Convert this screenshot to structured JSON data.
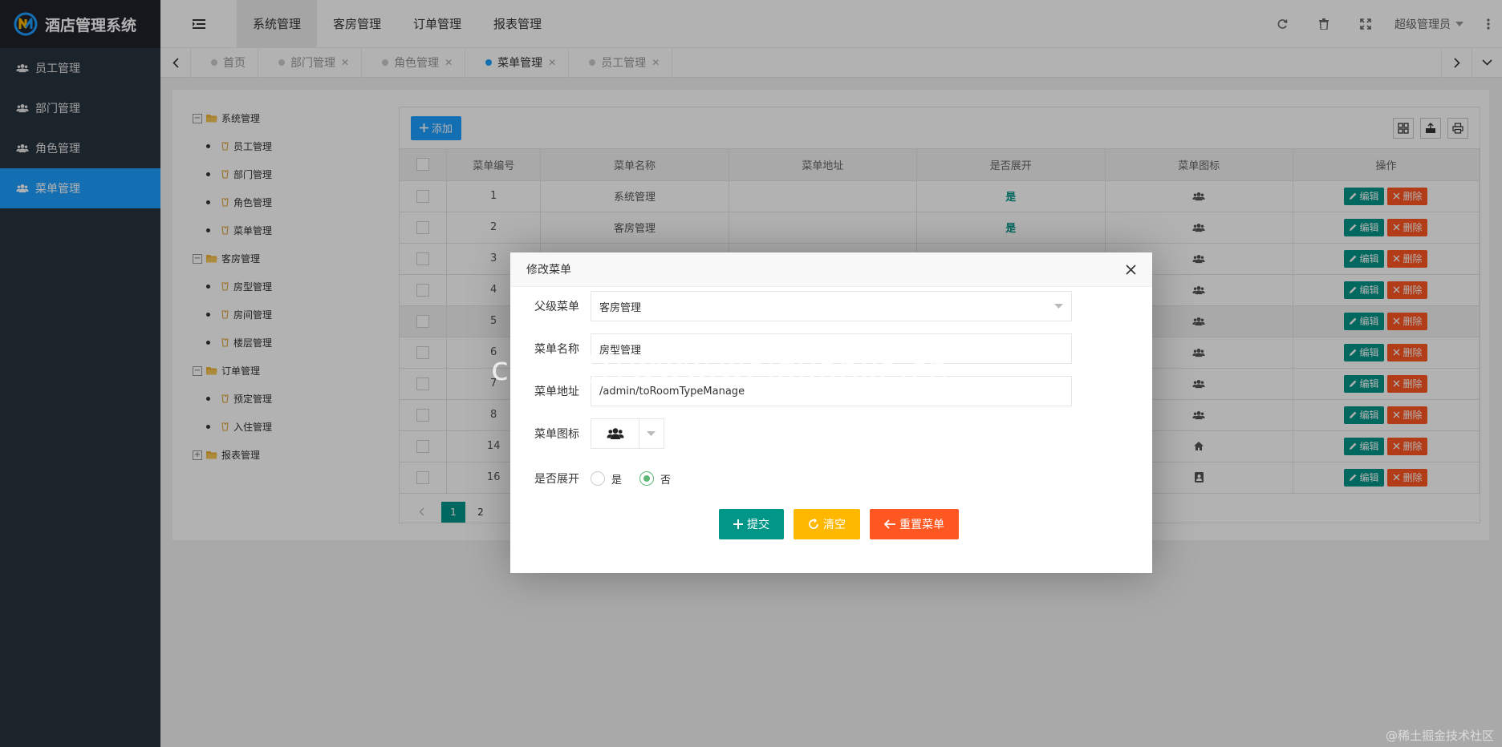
{
  "app": {
    "title": "酒店管理系统"
  },
  "sidebar": {
    "items": [
      {
        "label": "员工管理",
        "active": false
      },
      {
        "label": "部门管理",
        "active": false
      },
      {
        "label": "角色管理",
        "active": false
      },
      {
        "label": "菜单管理",
        "active": true
      }
    ]
  },
  "header": {
    "tabs": [
      {
        "label": "系统管理",
        "active": true
      },
      {
        "label": "客房管理",
        "active": false
      },
      {
        "label": "订单管理",
        "active": false
      },
      {
        "label": "报表管理",
        "active": false
      }
    ],
    "user": "超级管理员"
  },
  "page_tabs": [
    {
      "label": "首页",
      "active": false,
      "closable": false
    },
    {
      "label": "部门管理",
      "active": false,
      "closable": true
    },
    {
      "label": "角色管理",
      "active": false,
      "closable": true
    },
    {
      "label": "菜单管理",
      "active": true,
      "closable": true
    },
    {
      "label": "员工管理",
      "active": false,
      "closable": true
    }
  ],
  "tree": [
    {
      "label": "系统管理",
      "expanded": true,
      "children": [
        "员工管理",
        "部门管理",
        "角色管理",
        "菜单管理"
      ]
    },
    {
      "label": "客房管理",
      "expanded": true,
      "children": [
        "房型管理",
        "房间管理",
        "楼层管理"
      ]
    },
    {
      "label": "订单管理",
      "expanded": true,
      "children": [
        "预定管理",
        "入住管理"
      ]
    },
    {
      "label": "报表管理",
      "expanded": false,
      "children": []
    }
  ],
  "toolbar": {
    "add_label": "添加"
  },
  "table": {
    "columns": [
      "菜单编号",
      "菜单名称",
      "菜单地址",
      "是否展开",
      "菜单图标",
      "操作"
    ],
    "rows": [
      {
        "id": "1",
        "name": "系统管理",
        "url": "",
        "open": "是",
        "icon": "users-icon"
      },
      {
        "id": "2",
        "name": "客房管理",
        "url": "",
        "open": "是",
        "icon": "users-icon"
      },
      {
        "id": "3",
        "name": "",
        "url": "",
        "open": "",
        "icon": "users-icon"
      },
      {
        "id": "4",
        "name": "",
        "url": "",
        "open": "",
        "icon": "users-icon"
      },
      {
        "id": "5",
        "name": "",
        "url": "",
        "open": "",
        "icon": "users-icon"
      },
      {
        "id": "6",
        "name": "",
        "url": "",
        "open": "",
        "icon": "users-icon"
      },
      {
        "id": "7",
        "name": "",
        "url": "",
        "open": "",
        "icon": "users-icon"
      },
      {
        "id": "8",
        "name": "",
        "url": "",
        "open": "",
        "icon": "users-icon"
      },
      {
        "id": "14",
        "name": "",
        "url": "",
        "open": "",
        "icon": "home-icon"
      },
      {
        "id": "16",
        "name": "",
        "url": "",
        "open": "",
        "icon": "contact-icon"
      }
    ],
    "edit_label": "编辑",
    "delete_label": "删除",
    "highlighted_row": "5"
  },
  "pagination": {
    "pages": [
      "1",
      "2"
    ],
    "current": "1"
  },
  "modal": {
    "title": "修改菜单",
    "fields": {
      "parent_label": "父级菜单",
      "parent_value": "客房管理",
      "name_label": "菜单名称",
      "name_value": "房型管理",
      "url_label": "菜单地址",
      "url_value": "/admin/toRoomTypeManage",
      "icon_label": "菜单图标",
      "icon_value": "users-icon",
      "spread_label": "是否展开",
      "spread_options": [
        "是",
        "否"
      ],
      "spread_selected": "否"
    },
    "buttons": {
      "submit": "提交",
      "clear": "清空",
      "reset": "重置菜单"
    }
  },
  "watermark": {
    "center": "cn国观客www.weiguanke.cn",
    "corner": "@稀土掘金技术社区"
  },
  "colors": {
    "primary": "#1e9fff",
    "teal": "#009688",
    "orange": "#ffb800",
    "red": "#ff5722",
    "sidebar": "#28333e"
  }
}
